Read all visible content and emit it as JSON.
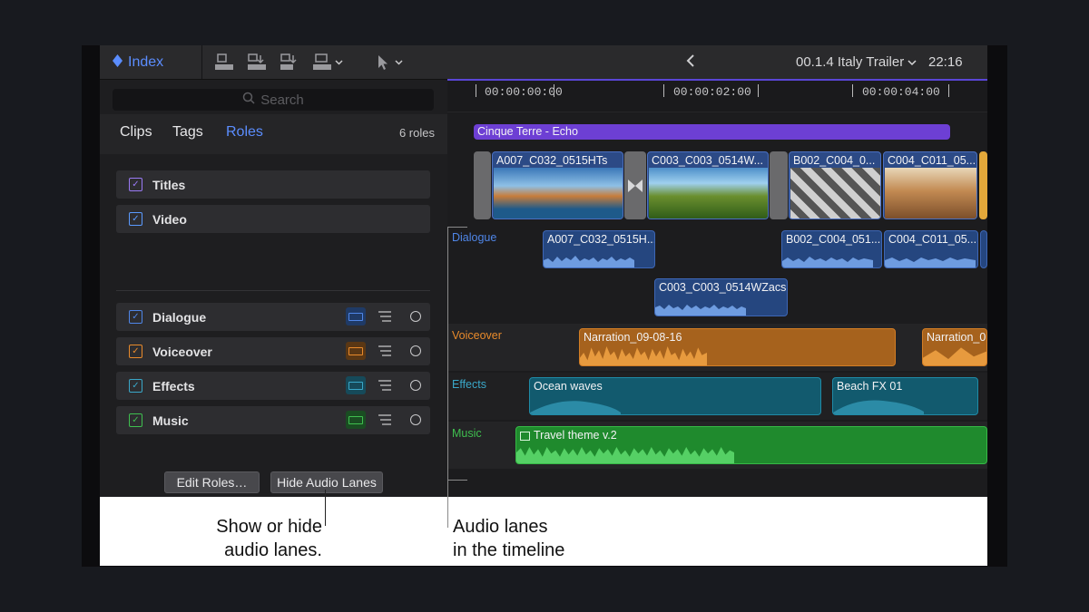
{
  "toolbar": {
    "index_label": "Index",
    "project_name": "00.1.4 Italy Trailer",
    "duration": "22:16"
  },
  "panel": {
    "search_placeholder": "Search",
    "tabs": [
      {
        "label": "Clips",
        "active": false
      },
      {
        "label": "Tags",
        "active": false
      },
      {
        "label": "Roles",
        "active": true
      }
    ],
    "roles_count": "6 roles",
    "video_roles": [
      {
        "label": "Titles",
        "color": "#9a7af5"
      },
      {
        "label": "Video",
        "color": "#5b9bff"
      }
    ],
    "audio_roles": [
      {
        "label": "Dialogue",
        "color": "#4f86e8"
      },
      {
        "label": "Voiceover",
        "color": "#e88a2b"
      },
      {
        "label": "Effects",
        "color": "#3aa7c8"
      },
      {
        "label": "Music",
        "color": "#3fbf4f"
      }
    ],
    "edit_roles_button": "Edit Roles…",
    "hide_lanes_button": "Hide Audio Lanes"
  },
  "timeline": {
    "timecodes": [
      "00:00:00:00",
      "00:00:02:00",
      "00:00:04:00"
    ],
    "title_clip": "Cinque Terre - Echo",
    "video_clips": [
      "A007_C032_0515HTs",
      "C003_C003_0514W...",
      "B002_C004_0...",
      "C004_C011_05..."
    ],
    "lanes": {
      "dialogue": {
        "label": "Dialogue",
        "clips": [
          "A007_C032_0515H...",
          "B002_C004_051...",
          "C004_C011_05...",
          "C003_C003_0514WZacs"
        ]
      },
      "voiceover": {
        "label": "Voiceover",
        "clips": [
          "Narration_09-08-16",
          "Narration_0"
        ]
      },
      "effects": {
        "label": "Effects",
        "clips": [
          "Ocean waves",
          "Beach FX 01"
        ]
      },
      "music": {
        "label": "Music",
        "clips": [
          "Travel theme v.2"
        ]
      }
    }
  },
  "callouts": {
    "show_hide_line1": "Show or hide",
    "show_hide_line2": "audio lanes.",
    "audio_lanes_line1": "Audio lanes",
    "audio_lanes_line2": "in the timeline"
  }
}
